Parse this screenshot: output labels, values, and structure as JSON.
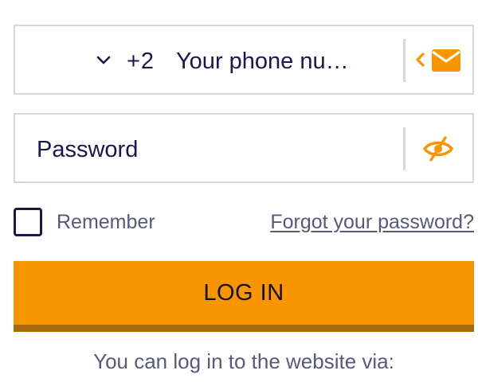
{
  "phone_field": {
    "country_code": "+2",
    "placeholder": "Your phone nu…",
    "dropdown_icon": "chevron-down-icon",
    "switch_icon": "chevron-left-icon",
    "mode_icon": "envelope-icon"
  },
  "password_field": {
    "placeholder": "Password",
    "toggle_icon": "eye-slash-icon"
  },
  "remember": {
    "label": "Remember",
    "checked": false
  },
  "forgot_link": "Forgot your password?",
  "login_button": "LOG IN",
  "login_via": "You can log in to the website via:",
  "colors": {
    "accent": "#f99500",
    "accent_shadow": "#a8690c",
    "text_dark": "#1a1650",
    "text_muted": "#58587c",
    "border": "#d6d8de"
  }
}
